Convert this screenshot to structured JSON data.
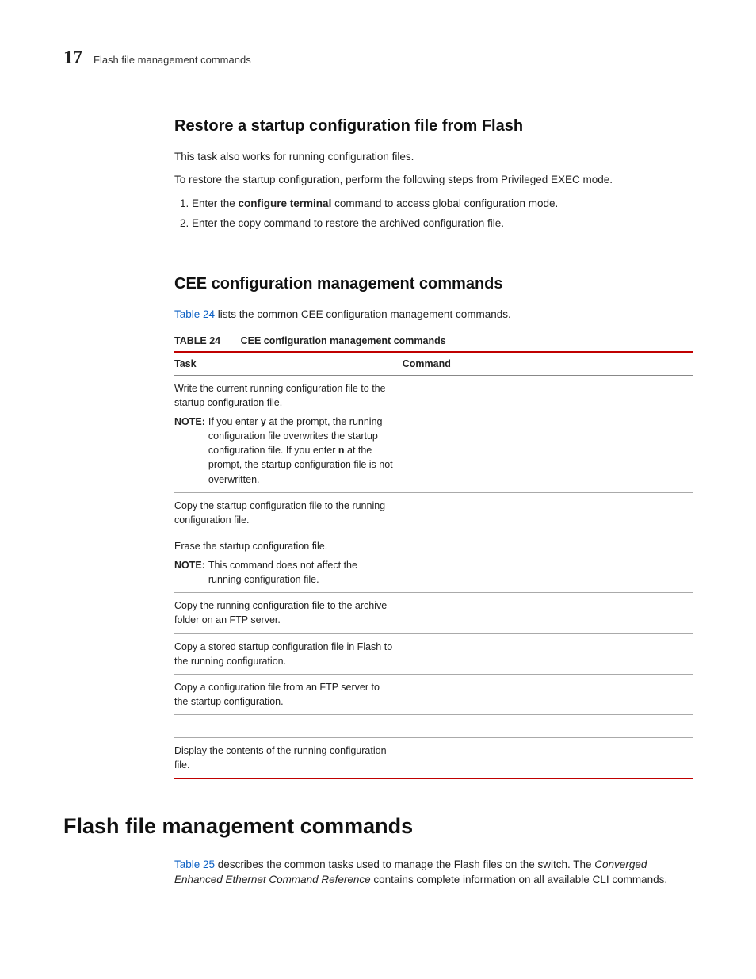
{
  "running_head": {
    "chapter_number": "17",
    "text": "Flash file management commands"
  },
  "section1": {
    "heading": "Restore a startup configuration file from Flash",
    "p1": "This task also works for running configuration files.",
    "p2": "To restore the startup configuration, perform the following steps from Privileged EXEC mode.",
    "step1_pre": "Enter the ",
    "step1_cmd": "configure terminal",
    "step1_post": " command to access global configuration mode.",
    "step2": "Enter the copy command to restore the archived configuration file."
  },
  "section2": {
    "heading": "CEE configuration management commands",
    "intro_link": "Table 24",
    "intro_rest": " lists the common CEE configuration management commands.",
    "table_number": "TABLE 24",
    "table_title": "CEE configuration management commands",
    "header_task": "Task",
    "header_cmd": "Command",
    "rows": [
      {
        "task": "Write the current running configuration file to the startup configuration file.",
        "note_label": "NOTE:",
        "note_pre": "If you enter ",
        "note_y": "y",
        "note_mid": " at the prompt, the running configuration file overwrites the startup configuration file. If you enter ",
        "note_n": "n",
        "note_post": " at the prompt, the startup configuration file is not overwritten."
      },
      {
        "task": "Copy the startup configuration file to the running configuration file."
      },
      {
        "task": "Erase the startup configuration file.",
        "note_label": "NOTE:",
        "note_body": "This command does not affect the running configuration file."
      },
      {
        "task": "Copy the running configuration file to the archive folder on an FTP server."
      },
      {
        "task": "Copy a stored startup configuration file in Flash to the running configuration."
      },
      {
        "task": "Copy a configuration file from an FTP server to the startup configuration."
      },
      {
        "task": "Display the contents of the running configuration file."
      }
    ]
  },
  "section3": {
    "heading": "Flash file management commands",
    "intro_link": "Table 25",
    "intro_mid": " describes the common tasks used to manage the Flash files on the switch. The ",
    "intro_em": "Converged Enhanced Ethernet Command Reference",
    "intro_post": " contains complete information on all available CLI commands."
  }
}
